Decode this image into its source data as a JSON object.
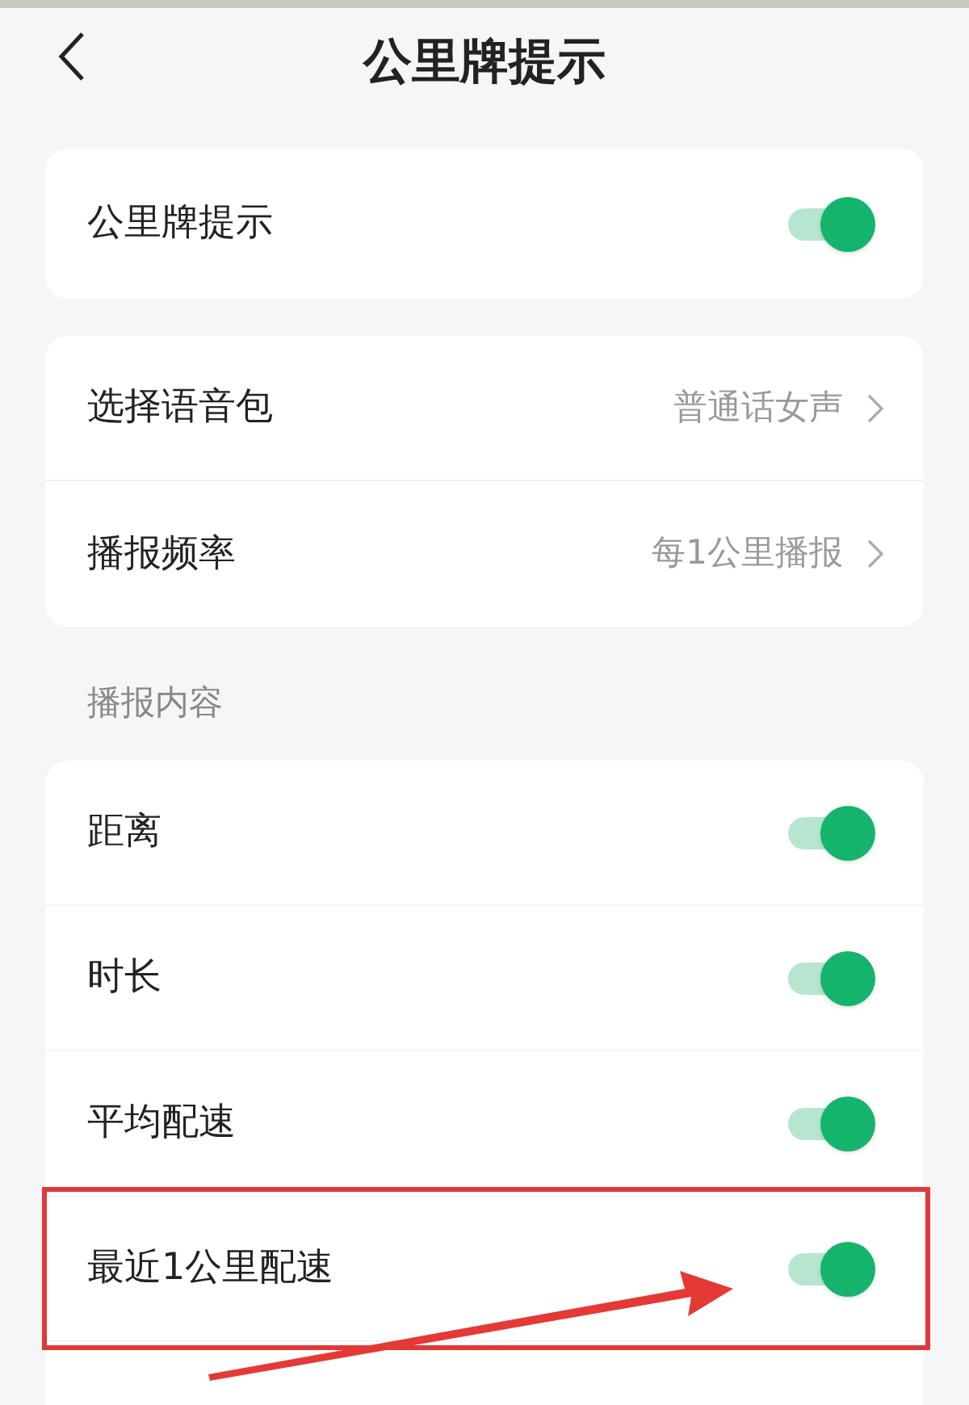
{
  "header": {
    "title": "公里牌提示"
  },
  "main_toggle": {
    "label": "公里牌提示",
    "on": true
  },
  "settings": [
    {
      "label": "选择语音包",
      "value": "普通话女声"
    },
    {
      "label": "播报频率",
      "value": "每1公里播报"
    }
  ],
  "section_label": "播报内容",
  "content_items": [
    {
      "label": "距离",
      "on": true,
      "highlighted": false
    },
    {
      "label": "时长",
      "on": true,
      "highlighted": false
    },
    {
      "label": "平均配速",
      "on": true,
      "highlighted": false
    },
    {
      "label": "最近1公里配速",
      "on": true,
      "highlighted": true
    }
  ]
}
